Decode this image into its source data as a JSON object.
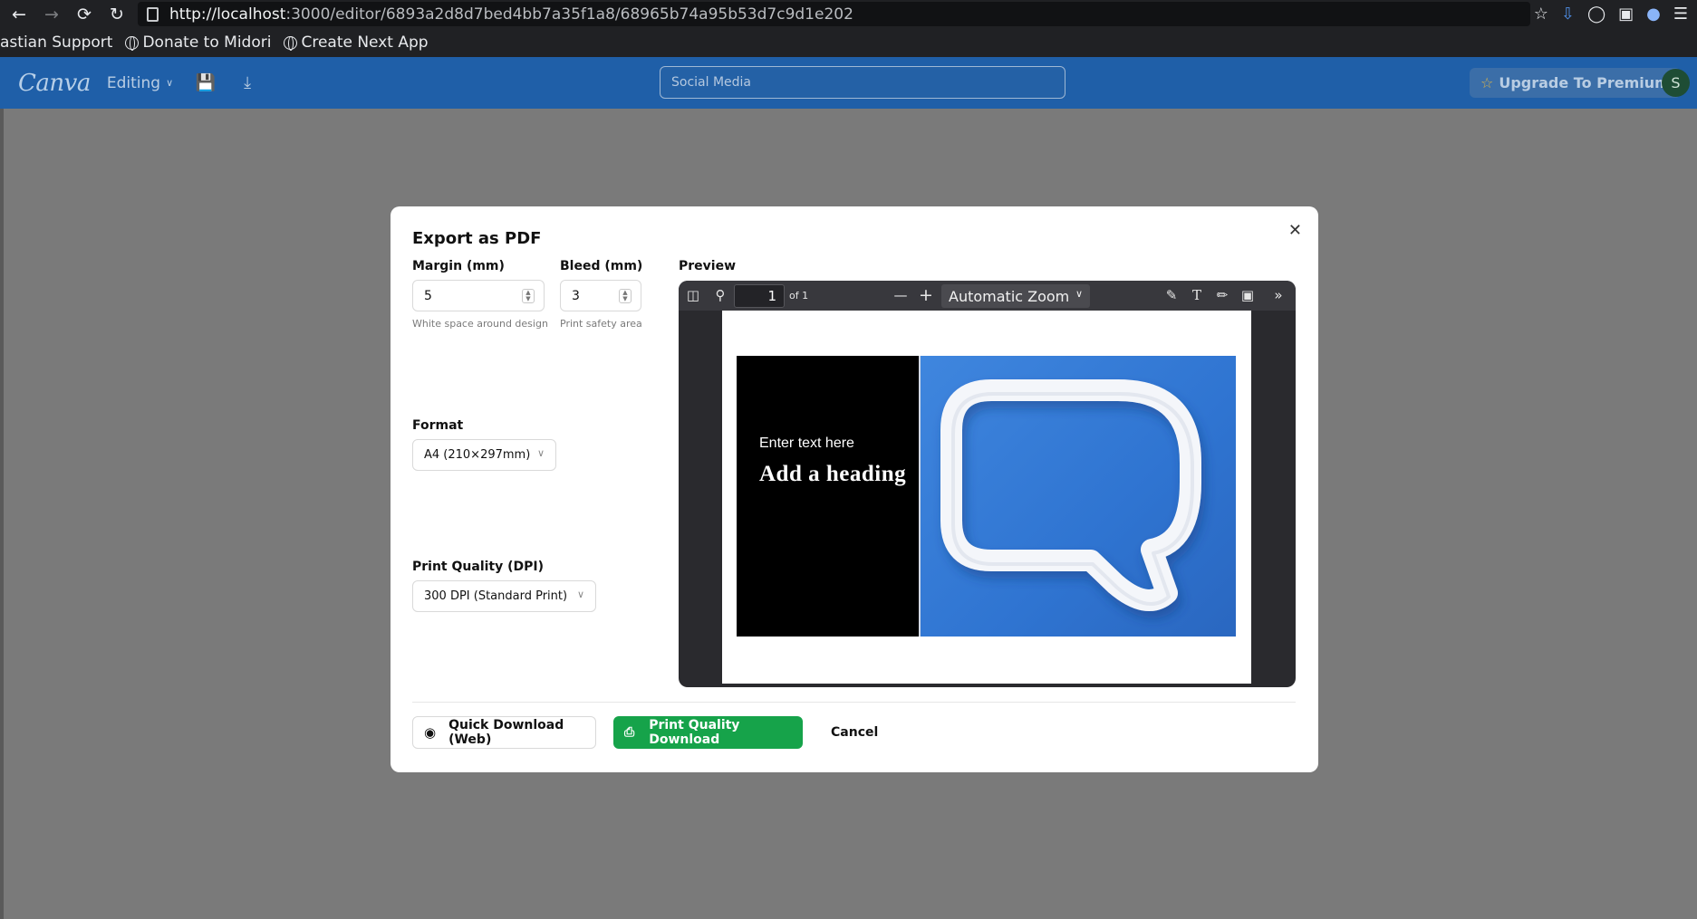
{
  "browser": {
    "url_host": "http://localhost",
    "url_path": ":3000/editor/6893a2d8d7bed4bb7a35f1a8/68965b74a95b53d7c9d1e202",
    "bookmarks": [
      "astian Support",
      "Donate to Midori",
      "Create Next App"
    ]
  },
  "app": {
    "logo": "Canva",
    "mode_label": "Editing",
    "search_value": "Social Media",
    "upgrade_label": "Upgrade To Premium",
    "avatar_initial": "S",
    "colors": {
      "header": "#1f5fa8",
      "primary_button": "#16a34a"
    }
  },
  "modal": {
    "title": "Export as PDF",
    "margin": {
      "label": "Margin (mm)",
      "value": "5",
      "hint": "White space around design"
    },
    "bleed": {
      "label": "Bleed (mm)",
      "value": "3",
      "hint": "Print safety area"
    },
    "format": {
      "label": "Format",
      "value": "A4 (210×297mm)"
    },
    "quality": {
      "label": "Print Quality (DPI)",
      "value": "300 DPI (Standard Print)"
    },
    "preview": {
      "label": "Preview",
      "page_number": "1",
      "page_total": "of 1",
      "zoom": "Automatic Zoom",
      "design_subtext": "Enter text here",
      "design_heading": "Add a heading"
    },
    "buttons": {
      "quick_download": "Quick Download (Web)",
      "print_download": "Print Quality Download",
      "cancel": "Cancel"
    }
  }
}
